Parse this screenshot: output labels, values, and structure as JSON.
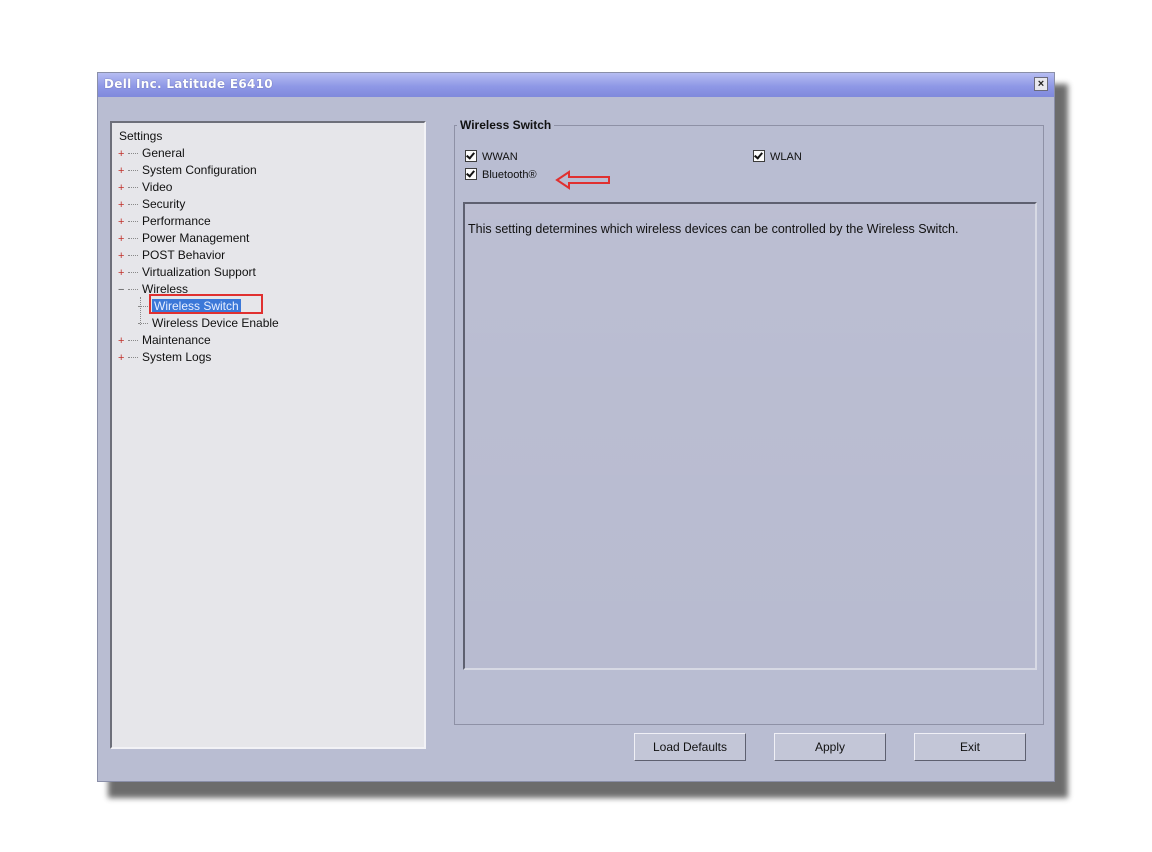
{
  "window": {
    "title": "Dell Inc. Latitude E6410",
    "close_glyph": "×"
  },
  "tree": {
    "root": "Settings",
    "items": [
      {
        "label": "General",
        "expander": "+"
      },
      {
        "label": "System Configuration",
        "expander": "+"
      },
      {
        "label": "Video",
        "expander": "+"
      },
      {
        "label": "Security",
        "expander": "+"
      },
      {
        "label": "Performance",
        "expander": "+"
      },
      {
        "label": "Power Management",
        "expander": "+"
      },
      {
        "label": "POST Behavior",
        "expander": "+"
      },
      {
        "label": "Virtualization Support",
        "expander": "+"
      },
      {
        "label": "Wireless",
        "expander": "−"
      },
      {
        "label": "Maintenance",
        "expander": "+"
      },
      {
        "label": "System Logs",
        "expander": "+"
      }
    ],
    "wireless_children": [
      {
        "label": "Wireless Switch",
        "selected": true
      },
      {
        "label": "Wireless Device Enable",
        "selected": false
      }
    ]
  },
  "panel": {
    "title": "Wireless Switch",
    "checkboxes": [
      {
        "label": "WWAN",
        "checked": true
      },
      {
        "label": "WLAN",
        "checked": true
      },
      {
        "label": "Bluetooth®",
        "checked": true
      }
    ],
    "description": "This setting determines which wireless devices can be controlled by the Wireless Switch."
  },
  "buttons": {
    "load_defaults": "Load Defaults",
    "apply": "Apply",
    "exit": "Exit"
  },
  "annotation_color": "#e03030",
  "selection_color": "#3b78d8"
}
